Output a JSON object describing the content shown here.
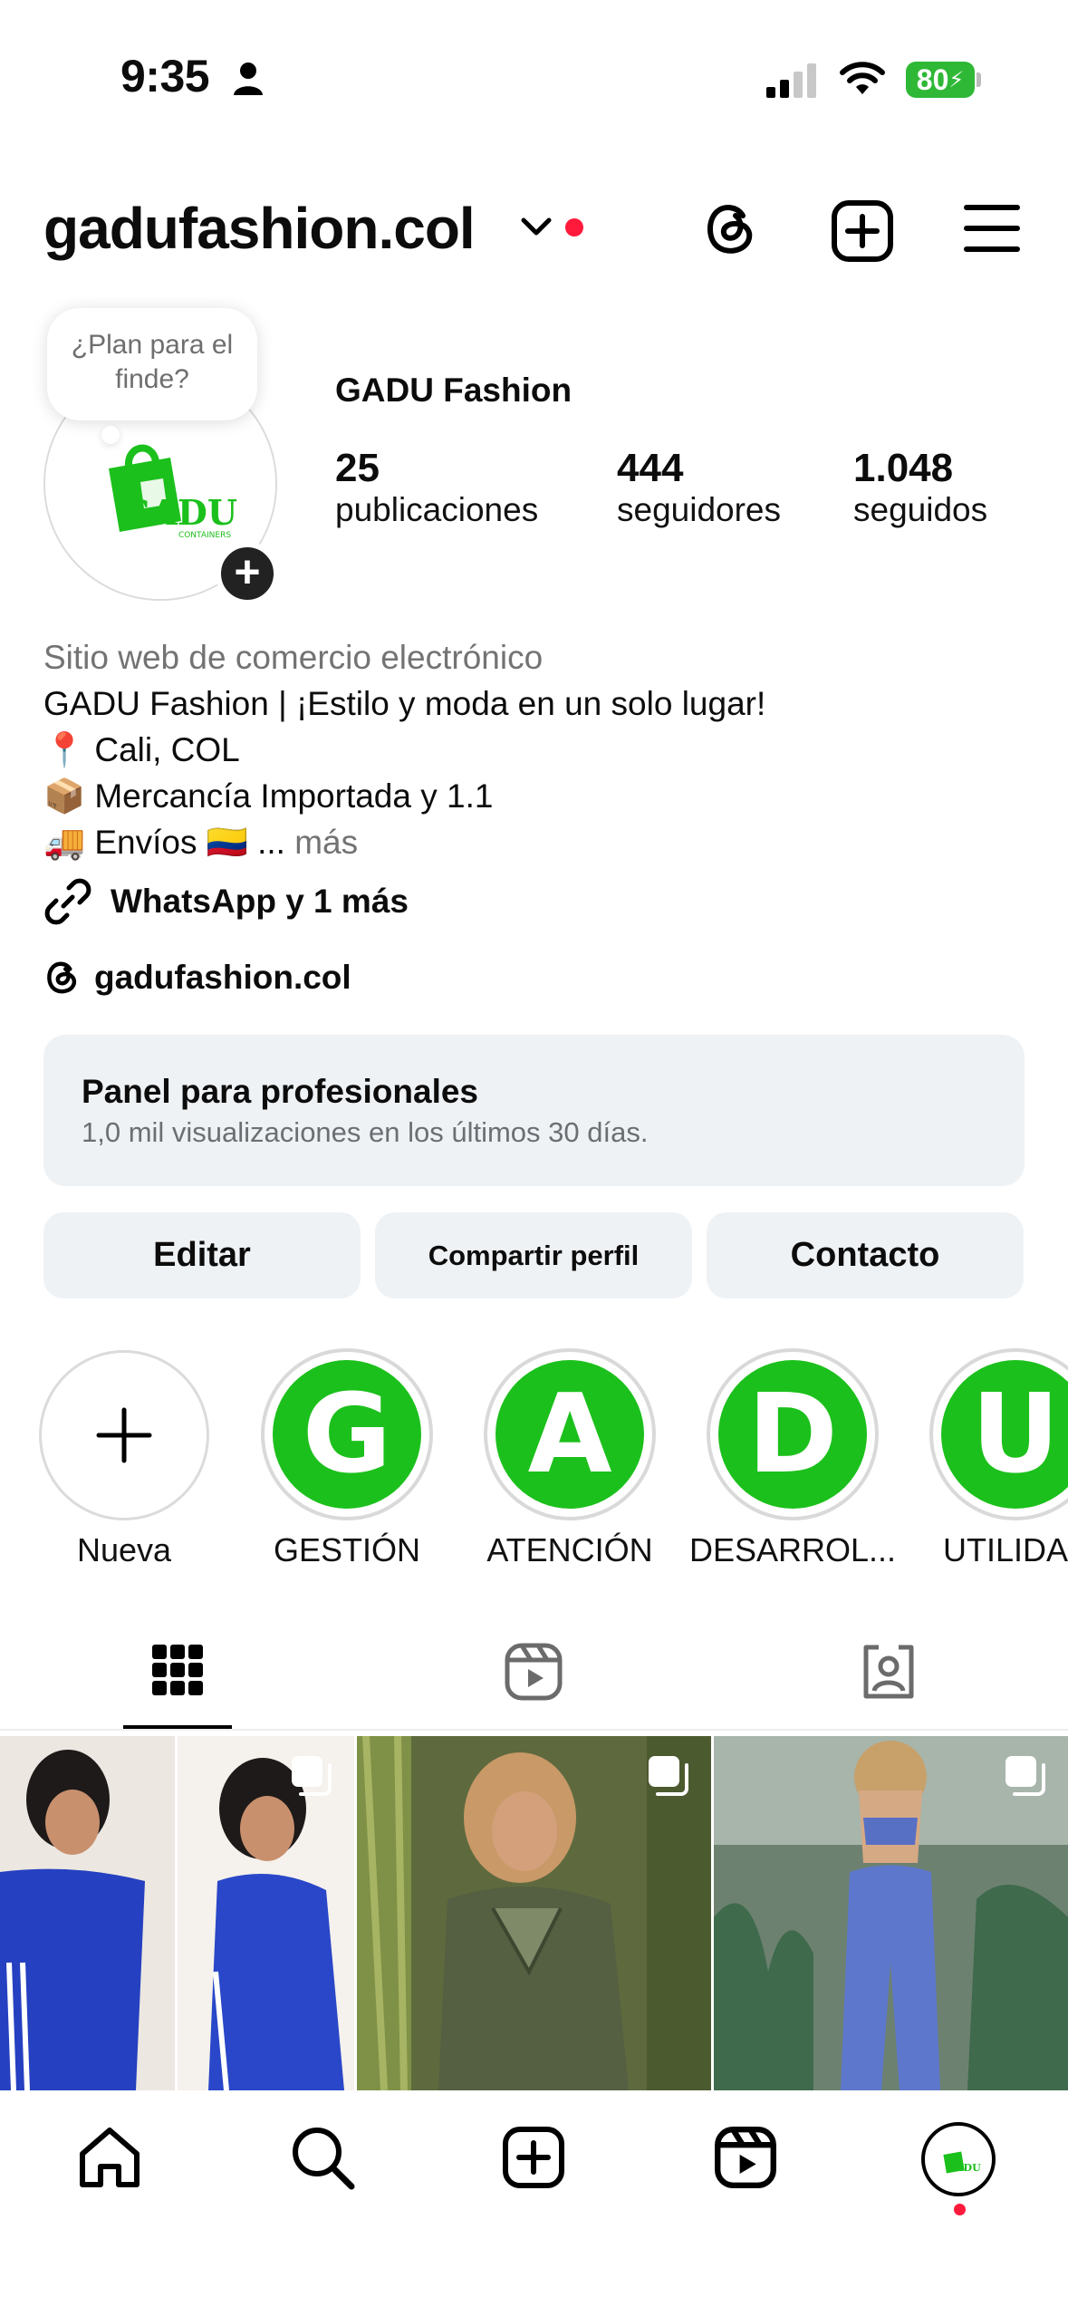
{
  "status_bar": {
    "time": "9:35",
    "battery": "80"
  },
  "header": {
    "username": "gadufashion.col"
  },
  "profile": {
    "note": "¿Plan para el finde?",
    "avatar_text": "GADU",
    "avatar_subtext": "CONTAINERS",
    "display_name": "GADU Fashion",
    "stats": [
      {
        "value": "25",
        "label": "publicaciones"
      },
      {
        "value": "444",
        "label": "seguidores"
      },
      {
        "value": "1.048",
        "label": "seguidos"
      }
    ],
    "category": "Sitio web de comercio electrónico",
    "bio_lines": [
      "GADU Fashion | ¡Estilo y moda en un solo lugar!",
      "📍 Cali, COL",
      "📦 Mercancía Importada y 1.1",
      "🚚 Envíos 🇨🇴 ..."
    ],
    "more": "más",
    "link": "WhatsApp y 1 más",
    "threads_handle": "gadufashion.col"
  },
  "dashboard": {
    "title": "Panel para profesionales",
    "subtitle": "1,0 mil visualizaciones en los últimos 30 días."
  },
  "buttons": {
    "edit": "Editar",
    "share": "Compartir perfil",
    "contact": "Contacto"
  },
  "highlights": [
    {
      "label": "Nueva",
      "letter": "+"
    },
    {
      "label": "GESTIÓN",
      "letter": "G"
    },
    {
      "label": "ATENCIÓN",
      "letter": "A"
    },
    {
      "label": "DESARROL...",
      "letter": "D"
    },
    {
      "label": "UTILIDA",
      "letter": "U"
    }
  ],
  "tabs": [
    "grid-icon",
    "reels-icon",
    "tagged-icon"
  ],
  "posts": [
    {
      "kind": "carousel",
      "palette": [
        "#e9e4df",
        "#2440b8",
        "#f4f0ea"
      ]
    },
    {
      "kind": "carousel",
      "palette": [
        "#6b7a3a",
        "#5b6640",
        "#c4945e"
      ]
    },
    {
      "kind": "carousel",
      "palette": [
        "#6b7f72",
        "#5a6fbf",
        "#c9d0cc"
      ]
    }
  ],
  "nav": [
    "home-icon",
    "search-icon",
    "create-icon",
    "reels-icon",
    "profile-avatar"
  ],
  "colors": {
    "accent_green": "#1cc01c",
    "notification_red": "#ff1a3c",
    "panel_bg": "#eff2f5"
  }
}
